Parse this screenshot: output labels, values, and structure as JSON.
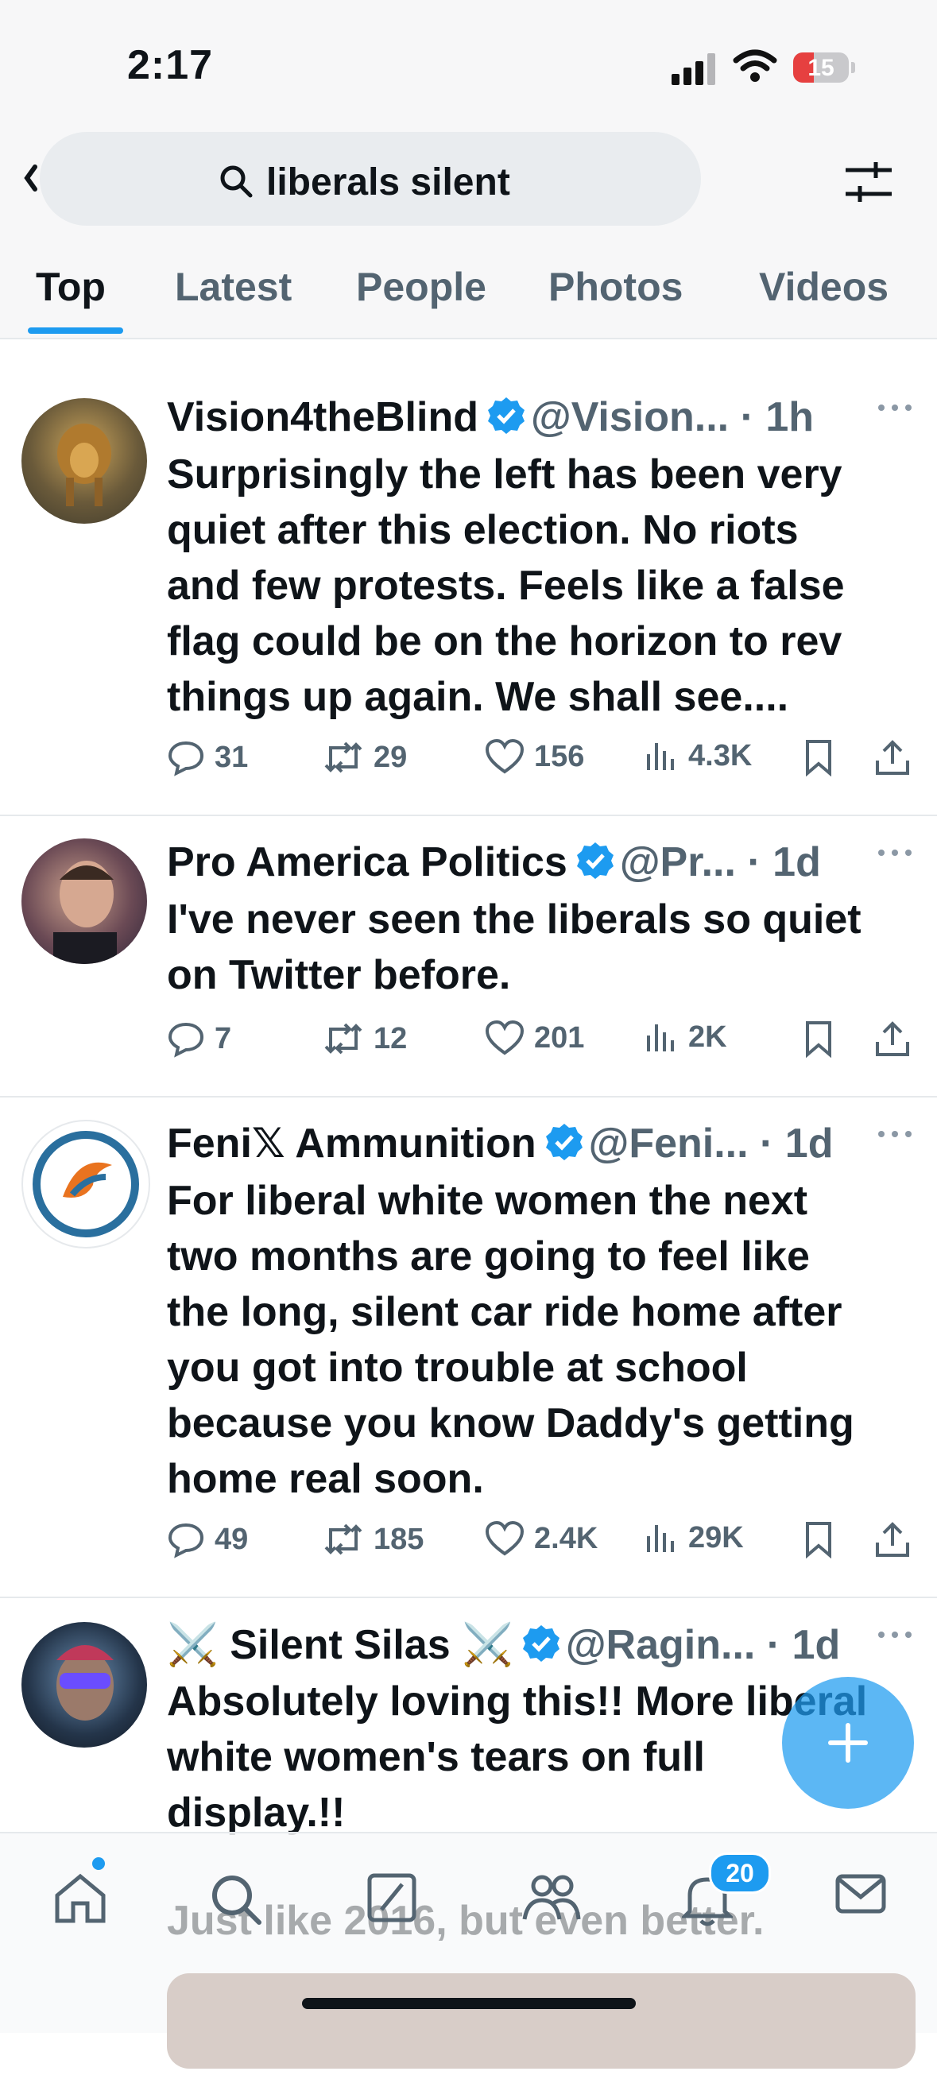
{
  "status": {
    "time": "2:17",
    "battery": "15"
  },
  "search": {
    "query": "liberals silent"
  },
  "tabs": [
    "Top",
    "Latest",
    "People",
    "Photos",
    "Videos"
  ],
  "colors": {
    "accent": "#1d9bf0",
    "muted": "#536471",
    "text": "#0f1419"
  },
  "tweets": [
    {
      "name": "Vision4theBlind",
      "handle": "@Vision...",
      "time": "· 1h",
      "lines": [
        "Surprisingly the left has been very",
        "quiet after this election. No riots",
        "and few protests. Feels like a false",
        "flag could be on the horizon to rev",
        "things up again. We shall see...."
      ],
      "replies": "31",
      "reposts": "29",
      "likes": "156",
      "views": "4.3K"
    },
    {
      "name": "Pro America Politics",
      "handle": "@Pr...",
      "time": "· 1d",
      "lines": [
        "I've never seen the liberals so quiet",
        "on Twitter before."
      ],
      "replies": "7",
      "reposts": "12",
      "likes": "201",
      "views": "2K"
    },
    {
      "name": "Feni𝕏 Ammunition",
      "handle": "@Feni...",
      "time": "· 1d",
      "lines": [
        "For liberal white women the next",
        "two months are going to feel like",
        "the long, silent car ride home after",
        "you got into trouble at school",
        "because you know Daddy's getting",
        "home real soon."
      ],
      "replies": "49",
      "reposts": "185",
      "likes": "2.4K",
      "views": "29K"
    },
    {
      "name": "⚔️ Silent Silas ⚔️",
      "handle": "@Ragin...",
      "time": "· 1d",
      "lines": [
        "Absolutely loving this!! More liberal",
        "white women's tears on full",
        "display.!!"
      ],
      "extra": "Just like 2016, but even better."
    }
  ],
  "nav": {
    "notifications_count": "20"
  }
}
